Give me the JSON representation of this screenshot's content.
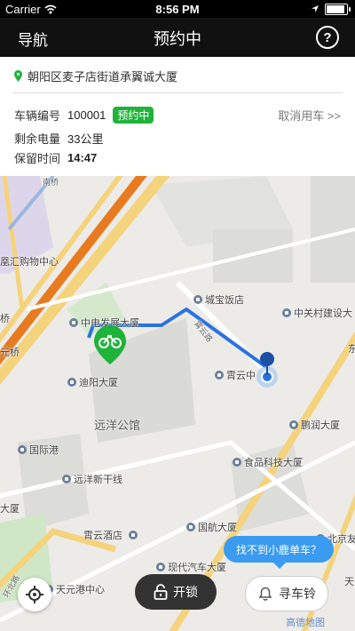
{
  "status_bar": {
    "carrier": "Carrier",
    "time": "8:56 PM"
  },
  "navbar": {
    "left": "导航",
    "title": "预约中",
    "help": "?"
  },
  "info": {
    "address": "朝阳区麦子店街道承翼诚大厦",
    "vehicle_label": "车辆编号",
    "vehicle_number": "100001",
    "status_badge": "预约中",
    "cancel": "取消用车 >>",
    "battery_label": "剩余电量",
    "battery_value": "33公里",
    "hold_label": "保留时间",
    "hold_value": "14:47"
  },
  "map": {
    "labels": [
      {
        "text": "中电发展大厦",
        "icon": true
      },
      {
        "text": "城宝饭店",
        "icon": true
      },
      {
        "text": "中关村建设大",
        "icon": true
      },
      {
        "text": "迪阳大厦",
        "icon": true
      },
      {
        "text": "霄云中",
        "icon": true
      },
      {
        "text": "远洋公馆",
        "icon": false
      },
      {
        "text": "鹏润大厦",
        "icon": true
      },
      {
        "text": "国际港",
        "icon": true
      },
      {
        "text": "食品科技大厦",
        "icon": true
      },
      {
        "text": "远洋新干线",
        "icon": true
      },
      {
        "text": "大厦",
        "icon": false
      },
      {
        "text": "国航大厦",
        "icon": true
      },
      {
        "text": "霄云酒店",
        "icon": true
      },
      {
        "text": "北京友",
        "icon": true
      },
      {
        "text": "现代汽车大厦",
        "icon": true
      },
      {
        "text": "天元港中心",
        "icon": true
      },
      {
        "text": "凰汇购物中心",
        "icon": false
      },
      {
        "text": "南桥",
        "icon": false
      },
      {
        "text": "桥",
        "icon": false
      },
      {
        "text": "元桥",
        "icon": false
      },
      {
        "text": "霄云路",
        "icon": false
      },
      {
        "text": "东",
        "icon": false
      },
      {
        "text": "天",
        "icon": false
      },
      {
        "text": "环北路",
        "icon": false
      }
    ],
    "bubble": "找不到小鹿单车？",
    "logo": "高德地图"
  },
  "bottom": {
    "unlock": "开锁",
    "bell": "寻车铃"
  },
  "colors": {
    "route": "#2a72e0",
    "bike_green": "#1fb33a",
    "bubble_blue": "#3a9bf0"
  }
}
